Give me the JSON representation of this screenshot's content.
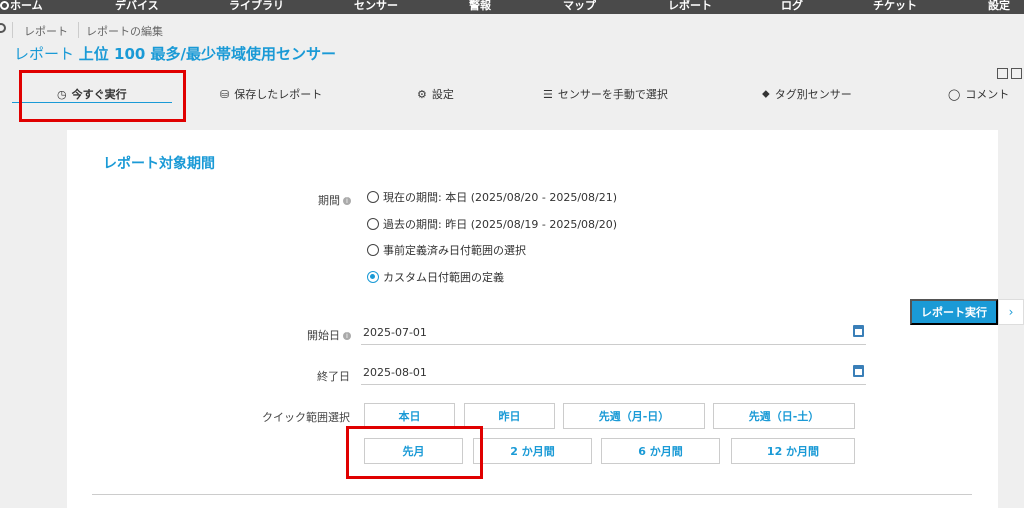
{
  "nav": {
    "items": [
      "ホーム",
      "デバイス",
      "ライブラリ",
      "センサー",
      "警報",
      "マップ",
      "レポート",
      "ログ",
      "チケット",
      "設定"
    ]
  },
  "breadcrumb": [
    "レポート",
    "レポートの編集"
  ],
  "title": {
    "prefix": "レポート",
    "name": "上位 100 最多/最少帯域使用センサー"
  },
  "tabs": [
    {
      "label": "今すぐ実行",
      "icon": "stopwatch-icon",
      "active": true
    },
    {
      "label": "保存したレポート",
      "icon": "database-icon"
    },
    {
      "label": "設定",
      "icon": "gear-icon"
    },
    {
      "label": "センサーを手動で選択",
      "icon": "sliders-icon"
    },
    {
      "label": "タグ別センサー",
      "icon": "tag-icon"
    },
    {
      "label": "コメント",
      "icon": "comment-icon"
    }
  ],
  "form": {
    "section_title": "レポート対象期間",
    "period_label": "期間",
    "period_options": [
      "現在の期間: 本日 (2025/08/20 - 2025/08/21)",
      "過去の期間: 昨日 (2025/08/19 - 2025/08/20)",
      "事前定義済み日付範囲の選択",
      "カスタム日付範囲の定義"
    ],
    "selected_option_index": 3,
    "start_label": "開始日",
    "start_value": "2025-07-01",
    "end_label": "終了日",
    "end_value": "2025-08-01",
    "quick_label": "クイック範囲選択",
    "quick_row1": [
      "本日",
      "昨日",
      "先週（月-日）",
      "先週（日-土）"
    ],
    "quick_row2": [
      "先月",
      "2 か月間",
      "6 か月間",
      "12 か月間"
    ]
  },
  "run_button": "レポート実行",
  "colors": {
    "accent": "#1a9ad6",
    "highlight": "#e00000",
    "nav_bg": "#4a4a4a"
  }
}
